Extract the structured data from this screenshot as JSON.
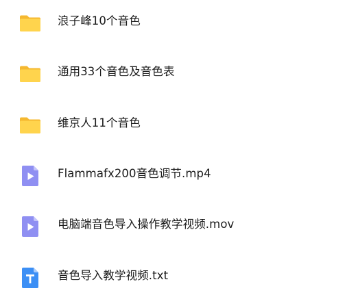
{
  "files": [
    {
      "name": "浪子峰10个音色",
      "icon": "folder-icon"
    },
    {
      "name": "通用33个音色及音色表",
      "icon": "folder-icon"
    },
    {
      "name": "维京人11个音色",
      "icon": "folder-icon"
    },
    {
      "name": "Flammafx200音色调节.mp4",
      "icon": "video-file-icon"
    },
    {
      "name": "电脑端音色导入操作教学视频.mov",
      "icon": "video-file-icon"
    },
    {
      "name": "音色导入教学视频.txt",
      "icon": "text-file-icon"
    }
  ],
  "colors": {
    "folder_back": "#F5B830",
    "folder_front": "#FFD44D",
    "video_file": "#8F8FF2",
    "text_file": "#3C8FF5"
  }
}
